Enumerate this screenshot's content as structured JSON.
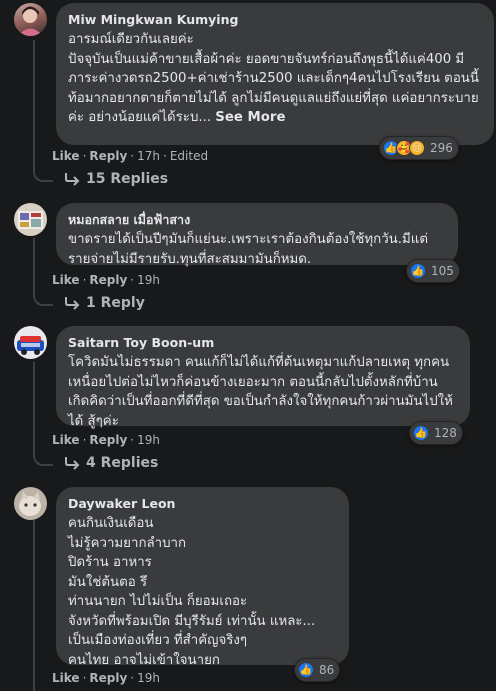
{
  "comments": [
    {
      "author": "Miw Mingkwan Kumying",
      "text": "อารมณ์เดียวกันเลยค่ะ\nปัจจุบันเป็นแม่ค้าขายเสื้อผ้าค่ะ ยอดขายจันทร์ก่อนถึงพุธนี้ได้แค่400 มีภาระค่างวดรถ2500+ค่าเช่าร้าน2500 และเด็กๆ4คนไปโรงเรียน ตอนนี้ท้อมากอยากตายก็ตายไม่ได้ ลูกไม่มีคนดูแลแย่ถึงแย่ที่สุด แค่อยากระบายค่ะ อย่างน้อยแค่ได้ระบ...",
      "see_more": "See More",
      "reaction_icons": [
        "like-icon",
        "care-icon",
        "sad-icon"
      ],
      "reaction_count": "296",
      "like": "Like",
      "reply": "Reply",
      "time": "17h",
      "edited": "Edited",
      "replies_label": "15 Replies"
    },
    {
      "author": "หมอกสลาย เมื่อฟ้าสาง",
      "text": "ขาดรายได้เป็นปีๆมันก็แย่นะ.เพราะเราต้องกินต้องใช้ทุกวัน.มีแต่รายจ่ายไม่มีรายรับ.ทุนที่สะสมมามันก็หมด.",
      "reaction_icons": [
        "like-icon"
      ],
      "reaction_count": "105",
      "like": "Like",
      "reply": "Reply",
      "time": "19h",
      "replies_label": "1 Reply"
    },
    {
      "author": "Saitarn Toy Boon-um",
      "text": "โควิดมันไม่ธรรมดา คนแก้ก็ไม่ได้แก้ที่ต้นเหตุมาแก้ปลายเหตุ ทุกคนเหนื่อยไปต่อไม่ไหวก็ค่อนข้างเยอะมาก ตอนนี้กลับไปตั้งหลักที่บ้านเกิดคิดว่าเป็นที่ออกที่ดีที่สุด ขอเป็นกำลังใจให้ทุกคนก้าวผ่านมันไปให้ได้ สู้ๆค่ะ",
      "reaction_icons": [
        "like-icon"
      ],
      "reaction_count": "128",
      "like": "Like",
      "reply": "Reply",
      "time": "19h",
      "replies_label": "4 Replies"
    },
    {
      "author": "Daywaker Leon",
      "text": "คนกินเงินเดือน\nไม่รู้ความยากลำบาก\nปิดร้าน อาหาร\nมันใช่ต้นตอ รึ\nท่านนายก ไปไม่เป็น ก็ยอมเถอะ\nจังหวัดที่พร้อมเปิด มีบุรีรัมย์ เท่านั้น แหละ...\nเป็นเมืองท่องเที่ยว ที่สำคัญจริงๆ\nคนไทย อาจไม่เข้าใจนายก",
      "reaction_icons": [
        "like-icon"
      ],
      "reaction_count": "86",
      "like": "Like",
      "reply": "Reply",
      "time": "19h"
    }
  ],
  "colors": {
    "background": "#18191a",
    "bubble": "#3a3b3c",
    "text": "#e4e6eb",
    "secondary": "#b0b3b8",
    "like_blue": "#1877f2"
  }
}
